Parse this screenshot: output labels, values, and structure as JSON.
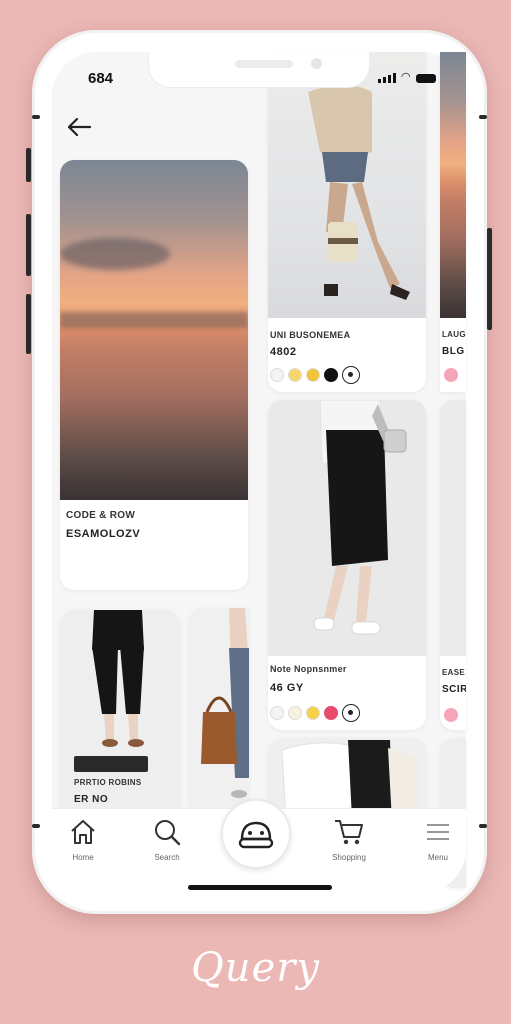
{
  "status_bar": {
    "time": "684"
  },
  "nav": {
    "back_icon": "arrow-left-icon"
  },
  "cards": {
    "sunset": {
      "title": "CODE & ROW",
      "subtitle": "ESAMOLOZV"
    },
    "knit_top": {
      "title": "UNI BUSONEMEA",
      "price": "4802",
      "swatches": [
        "#f3f3f3",
        "#f6d66a",
        "#f2c43a",
        "#111111"
      ]
    },
    "pencil_skirt": {
      "title": "Note Nopnsnmer",
      "price": "46 GY",
      "swatches": [
        "#f3f3f3",
        "#f7f1e0",
        "#f6d14a",
        "#e84a6a"
      ]
    },
    "trousers": {
      "tag": "",
      "title": "PRRTIO ROBINS",
      "price": "ER NO"
    },
    "edge_card_1": {
      "title": "LAUG",
      "price": "BLG"
    },
    "edge_card_2": {
      "title": "EASE",
      "price": "SCIR"
    }
  },
  "tabbar": {
    "items": [
      {
        "label": "Home",
        "icon": "home-icon"
      },
      {
        "label": "Search",
        "icon": "search-icon"
      },
      {
        "label": "",
        "icon": "bag-icon"
      },
      {
        "label": "Shopping",
        "icon": "cart-icon"
      },
      {
        "label": "Menu",
        "icon": "menu-icon"
      }
    ]
  },
  "brand": {
    "name": "Query"
  },
  "colors": {
    "background": "#ebb8b5",
    "accent_pink": "#f4a6b8"
  }
}
